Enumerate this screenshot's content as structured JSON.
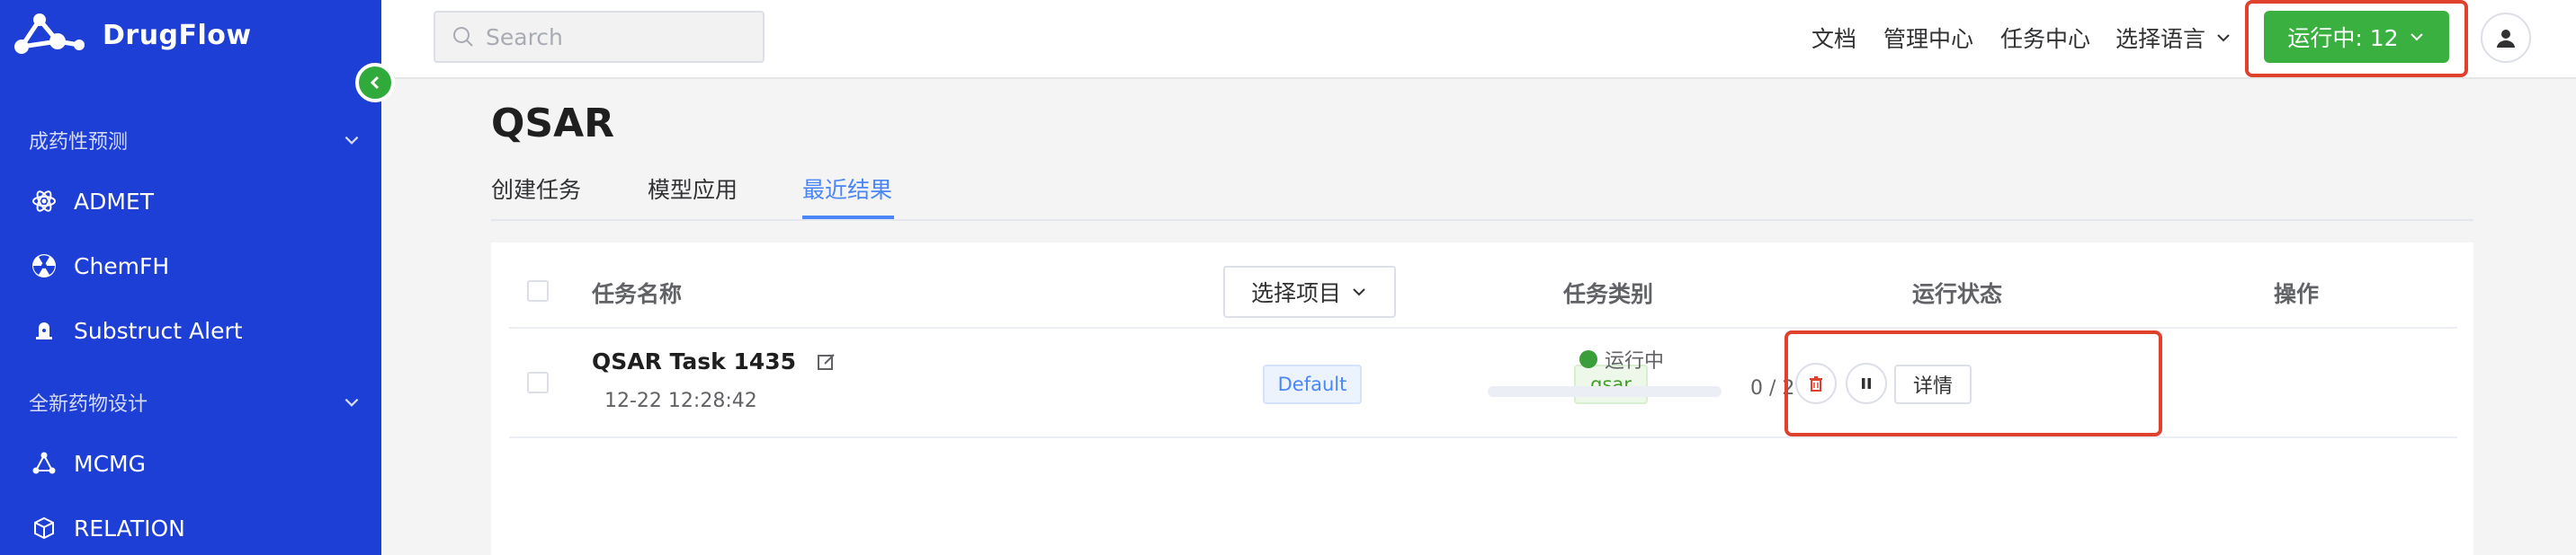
{
  "app": {
    "name": "DrugFlow"
  },
  "sidebar": {
    "groups": [
      {
        "title": "成药性预测",
        "items": [
          {
            "label": "ADMET",
            "icon": "atom-icon"
          },
          {
            "label": "ChemFH",
            "icon": "radiation-icon"
          },
          {
            "label": "Substruct Alert",
            "icon": "bell-icon"
          }
        ]
      },
      {
        "title": "全新药物设计",
        "items": [
          {
            "label": "MCMG",
            "icon": "molecule-icon"
          },
          {
            "label": "RELATION",
            "icon": "cube-icon"
          }
        ]
      }
    ]
  },
  "header": {
    "search_placeholder": "Search",
    "nav": [
      "文档",
      "管理中心",
      "任务中心",
      "选择语言"
    ],
    "running_label": "运行中: 12"
  },
  "page": {
    "title": "QSAR",
    "tabs": [
      {
        "label": "创建任务",
        "active": false
      },
      {
        "label": "模型应用",
        "active": false
      },
      {
        "label": "最近结果",
        "active": true
      }
    ]
  },
  "table": {
    "columns": {
      "name": "任务名称",
      "project": "选择项目",
      "category": "任务类别",
      "status": "运行状态",
      "actions": "操作"
    },
    "rows": [
      {
        "name": "QSAR Task 1435",
        "time": "12-22 12:28:42",
        "project": "Default",
        "category": "qsar",
        "status": "运行中",
        "progress": "0 / 2",
        "progress_fraction": 0,
        "detail_label": "详情"
      }
    ]
  },
  "colors": {
    "sidebar_bg": "#1d3fd6",
    "accent_green": "#3ab040",
    "tab_active": "#4a86f7",
    "highlight_red": "#e0412c"
  }
}
